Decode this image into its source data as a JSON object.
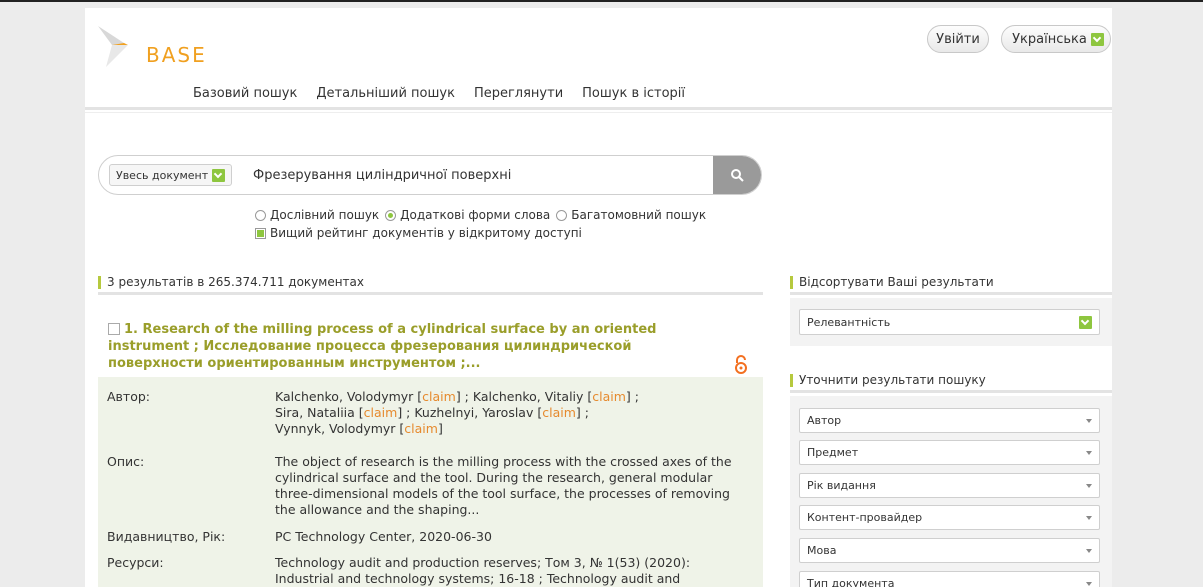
{
  "header": {
    "logo_text": "BASE",
    "login_label": "Увійти",
    "language_label": "Українська",
    "nav": [
      "Базовий пошук",
      "Детальніший пошук",
      "Переглянути",
      "Пошук в історії"
    ]
  },
  "search": {
    "scope_label": "Увесь документ",
    "query": "Фрезерування циліндричної поверхні",
    "mode_options": [
      "Дослівний пошук",
      "Додаткові форми слова",
      "Багатомовний пошук"
    ],
    "mode_selected": "Додаткові форми слова",
    "boost_open_access_label": "Вищий рейтинг документів у відкритому доступі",
    "boost_open_access_checked": true
  },
  "results": {
    "count_text": "3 результатів в 265.374.711 документах",
    "items": [
      {
        "title_line1": "1. Research of the milling process of a cylindrical surface by an oriented",
        "title_line2": "instrument ; Исследование процесса фрезерования цилиндрической",
        "title_line3": "поверхности ориентированным инструментом ;...",
        "author_label": "Автор:",
        "authors_line1_a": "Kalchenko, Volodymyr [",
        "authors_line1_b": "] ; Kalchenko, Vitaliy [",
        "authors_line1_c": "] ;",
        "authors_line2_a": "Sira, Nataliia [",
        "authors_line2_b": "] ; Kuzhelnyi, Yaroslav [",
        "authors_line2_c": "] ;",
        "authors_line3_a": "Vynnyk, Volodymyr [",
        "authors_line3_c": "]",
        "claim_label": "claim",
        "description_label": "Опис:",
        "description": "The object of research is the milling process with the crossed axes of the cylindrical surface and the tool. During the research, general modular three-dimensional models of the tool surface, the processes of removing the allowance and the shaping...",
        "publisher_label": "Видавництво, Рік:",
        "publisher": "PC Technology Center, 2020-06-30",
        "resources_label": "Ресурси:",
        "resources": "Technology audit and production reserves; Том 3, № 1(53) (2020): Industrial and technology systems; 16-18 ; Technology audit and"
      }
    ]
  },
  "sort": {
    "header": "Відсортувати Ваші результати",
    "selected": "Релевантність"
  },
  "refine": {
    "header": "Уточнити результати пошуку",
    "facets": [
      "Автор",
      "Предмет",
      "Рік видання",
      "Контент-провайдер",
      "Мова",
      "Тип документа"
    ]
  },
  "icons": {
    "logo": "base-logo-chevron",
    "search": "search-icon",
    "open_access": "open-access-icon",
    "dropdown": "chevron-down-icon"
  },
  "colors": {
    "accent_green": "#8ec63f",
    "title_olive": "#9a9e2a",
    "claim_orange": "#e68a2e",
    "logo_orange": "#f0a020"
  }
}
